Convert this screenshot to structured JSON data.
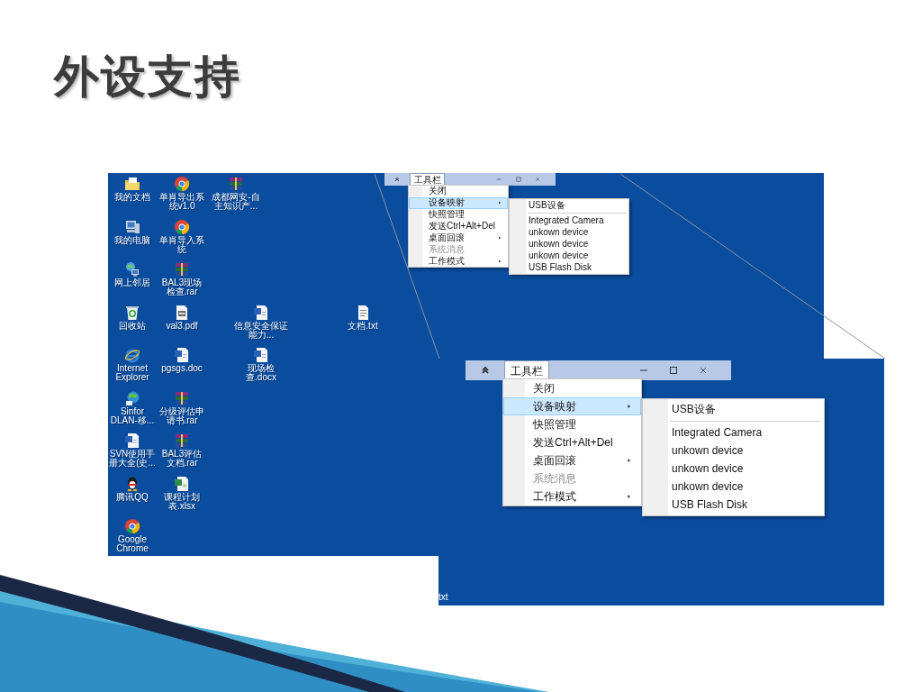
{
  "slide": {
    "title": "外设支持"
  },
  "desktop": {
    "icons": [
      {
        "label": "我的文档",
        "kind": "documents"
      },
      {
        "label": "我的电脑",
        "kind": "computer"
      },
      {
        "label": "网上邻居",
        "kind": "network"
      },
      {
        "label": "回收站",
        "kind": "recycle"
      },
      {
        "label": "Internet Explorer",
        "kind": "ie"
      },
      {
        "label": "Sinfor DLAN-移...",
        "kind": "globe"
      },
      {
        "label": "SVN使用手册大全(史...",
        "kind": "word"
      },
      {
        "label": "腾讯QQ",
        "kind": "qq"
      },
      {
        "label": "Google Chrome",
        "kind": "chrome"
      },
      {
        "label": "单肖导出系统v1.0",
        "kind": "chrome"
      },
      {
        "label": "单肖导入系统",
        "kind": "chrome"
      },
      {
        "label": "BAL3现场检查.rar",
        "kind": "rar"
      },
      {
        "label": "val3.pdf",
        "kind": "pdf"
      },
      {
        "label": "pgsgs.doc",
        "kind": "word"
      },
      {
        "label": "分级评估申请书.rar",
        "kind": "rar"
      },
      {
        "label": "BAL3评估文档.rar",
        "kind": "rar"
      },
      {
        "label": "课程计划表.xlsx",
        "kind": "excel"
      },
      {
        "label": "成都网安-自主知识产...",
        "kind": "rar"
      },
      {
        "label": "信息安全保证能力...",
        "kind": "word"
      },
      {
        "label": "现场检查.docx",
        "kind": "word"
      },
      {
        "label": "文档.txt",
        "kind": "txt"
      }
    ]
  },
  "toolbar_window": {
    "title": "工具栏",
    "menu": [
      {
        "label": "关闭",
        "selected": false,
        "disabled": false,
        "has_submenu": false
      },
      {
        "label": "设备映射",
        "selected": true,
        "disabled": false,
        "has_submenu": true,
        "submenu": {
          "header": "USB设备",
          "items": [
            "Integrated Camera",
            "unkown device",
            "unkown device",
            "unkown device",
            "USB Flash Disk"
          ]
        }
      },
      {
        "label": "快照管理",
        "selected": false,
        "disabled": false,
        "has_submenu": false
      },
      {
        "label": "发送Ctrl+Alt+Del",
        "selected": false,
        "disabled": false,
        "has_submenu": false
      },
      {
        "label": "桌面回滚",
        "selected": false,
        "disabled": false,
        "has_submenu": true
      },
      {
        "label": "系统消息",
        "selected": false,
        "disabled": true,
        "has_submenu": false
      },
      {
        "label": "工作模式",
        "selected": false,
        "disabled": false,
        "has_submenu": true
      }
    ]
  },
  "zoomed_view": {
    "toolbar_window": {
      "title": "工具栏",
      "menu": [
        {
          "label": "关闭",
          "selected": false,
          "disabled": false,
          "has_submenu": false
        },
        {
          "label": "设备映射",
          "selected": true,
          "disabled": false,
          "has_submenu": true,
          "submenu": {
            "header": "USB设备",
            "items": [
              "Integrated Camera",
              "unkown device",
              "unkown device",
              "unkown device",
              "USB Flash Disk"
            ]
          }
        },
        {
          "label": "快照管理",
          "selected": false,
          "disabled": false,
          "has_submenu": false
        },
        {
          "label": "发送Ctrl+Alt+Del",
          "selected": false,
          "disabled": false,
          "has_submenu": false
        },
        {
          "label": "桌面回滚",
          "selected": false,
          "disabled": false,
          "has_submenu": true
        },
        {
          "label": "系统消息",
          "selected": false,
          "disabled": true,
          "has_submenu": false
        },
        {
          "label": "工作模式",
          "selected": false,
          "disabled": false,
          "has_submenu": true
        }
      ]
    },
    "partial_label": "txt"
  }
}
